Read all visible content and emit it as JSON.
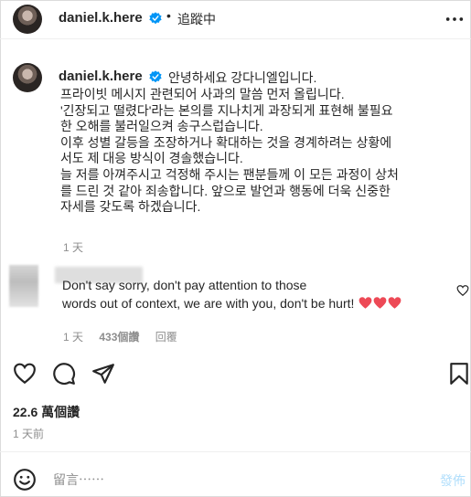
{
  "header": {
    "username": "daniel.k.here",
    "separator": "•",
    "follow_status": "追蹤中"
  },
  "caption": {
    "username": "daniel.k.here",
    "greeting": "안녕하세요 강다니엘입니다.",
    "lines": [
      "프라이빗 메시지 관련되어 사과의 말씀 먼저 올립니다.",
      "'긴장되고 떨렸다'라는 본의를 지나치게 과장되게 표현해 불필요",
      "한 오해를 불러일으켜 송구스럽습니다.",
      "이후 성별 갈등을 조장하거나 확대하는 것을 경계하려는 상황에",
      "서도 제 대응 방식이 경솔했습니다.",
      "늘 저를 아껴주시고 걱정해 주시는 팬분들께 이 모든 과정이 상처",
      "를 드린 것 같아 죄송합니다. 앞으로 발언과 행동에 더욱 신중한",
      "자세를 갖도록 하겠습니다."
    ],
    "time": "1 天"
  },
  "comment": {
    "line1": "Don't say sorry, don't pay attention to those",
    "line2": "words out of context, we are with you, don't be hurt!",
    "time": "1 天",
    "likes": "433個讚",
    "reply": "回覆"
  },
  "stats": {
    "views": "22.6 萬個讚",
    "posted": "1 天前"
  },
  "composer": {
    "placeholder": "留言⋯⋯",
    "post_label": "發佈"
  },
  "colors": {
    "verified": "#0095f6",
    "heart": "#ed4956",
    "post_disabled": "#b2dffc",
    "muted": "#8e8e8e"
  },
  "icons": [
    "more-icon",
    "verified-icon",
    "heart-icon",
    "comment-icon",
    "share-icon",
    "save-icon",
    "emoji-icon"
  ]
}
